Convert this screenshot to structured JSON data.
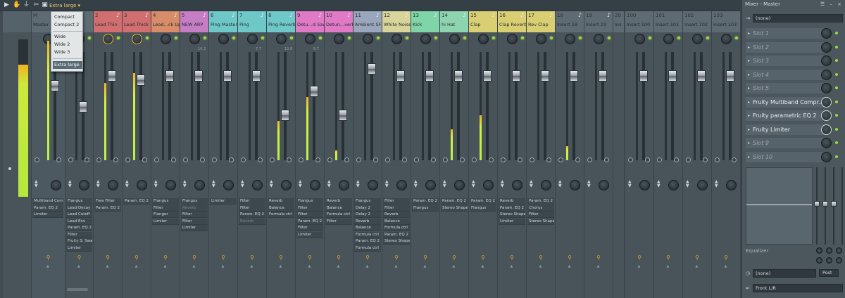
{
  "toolbar": {
    "layout_label": "Extra large",
    "icons": [
      "cursor-arrow-icon",
      "hand-icon",
      "pitchfork-icon",
      "scissors-icon",
      "panel-icon"
    ]
  },
  "layout_menu": {
    "items": [
      "Compact",
      "Compact 2",
      "Wide",
      "Wide 2",
      "Wide 3",
      "Extra large"
    ],
    "selected": "Extra large"
  },
  "channels": [
    {
      "num": "",
      "name": "",
      "color": "#56626a",
      "fx": []
    },
    {
      "num": "M",
      "name": "Master",
      "color": "#5f6b73",
      "fx": [
        "Multiband Comp",
        "Param. EQ 2",
        "Limiter"
      ]
    },
    {
      "num": "1",
      "name": "",
      "color": "#5f6b73",
      "fx": [
        "Flangus",
        "Lead Decay",
        "Lead Cutoff",
        "Lead Env",
        "Param. EQ 2",
        "Filter",
        "Fruity S. Swapper",
        "Limiter"
      ]
    },
    {
      "num": "2",
      "name": "Lead Thin",
      "color": "#d16f70",
      "fx": [
        "Free Filter",
        "Param. EQ 2"
      ]
    },
    {
      "num": "3",
      "name": "Lead Thick",
      "color": "#d16f70",
      "fx": [
        "Param. EQ 2"
      ]
    },
    {
      "num": "4",
      "name": "Lead...ck Up",
      "color": "#d88d68",
      "fx": [
        "Flangus",
        "Filter",
        "Flanger",
        "Limiter"
      ]
    },
    {
      "num": "5",
      "name": "NEW ARP",
      "color": "#c77dc4",
      "fx": [
        "Flangus",
        "Reverb",
        "Filter",
        "Filter",
        "Limiter"
      ]
    },
    {
      "num": "6",
      "name": "Ping Master",
      "color": "#6fc8c8",
      "fx": [
        "Limiter"
      ]
    },
    {
      "num": "7",
      "name": "Ping",
      "color": "#6fc8c8",
      "fx": [
        "Filter",
        "Filter",
        "Param. EQ 2",
        "Reverb"
      ]
    },
    {
      "num": "8",
      "name": "Ping Reverb",
      "color": "#6fc8c8",
      "fx": [
        "Reverb",
        "Balance",
        "Formula ctrl"
      ]
    },
    {
      "num": "9",
      "name": "Detu...d Saw",
      "color": "#e17ac6",
      "fx": [
        "Flangus",
        "Filter",
        "Filter",
        "Param. EQ 2",
        "Filter",
        "Limiter"
      ]
    },
    {
      "num": "10",
      "name": "Detun...verb",
      "color": "#e17ac6",
      "fx": [
        "Reverb",
        "Balance",
        "Formula ctrl",
        "Filter"
      ]
    },
    {
      "num": "11",
      "name": "Ambient SFX",
      "color": "#9aa6bb",
      "fx": [
        "Flangus",
        "Delay 2",
        "Delay 2",
        "Reverb",
        "Balance",
        "Formula ctrl",
        "Param. EQ 2",
        "Formula ctrl"
      ]
    },
    {
      "num": "12",
      "name": "White Noise",
      "color": "#d8d49a",
      "fx": [
        "Filter",
        "Filter",
        "Reverb",
        "Balance",
        "Formula ctrl",
        "Param. EQ 2",
        "Stereo Shaper"
      ]
    },
    {
      "num": "13",
      "name": "Kick",
      "color": "#7fd4a8",
      "fx": [
        "Param. EQ 2",
        "Flangus"
      ]
    },
    {
      "num": "14",
      "name": "hi Hat",
      "color": "#8fd4b0",
      "fx": [
        "Param. EQ 2",
        "Stereo Shaper"
      ]
    },
    {
      "num": "15",
      "name": "Clap",
      "color": "#d9cf72",
      "fx": [
        "Param. EQ 2",
        "Flangus"
      ]
    },
    {
      "num": "16",
      "name": "Clap Reverb",
      "color": "#d9cf72",
      "fx": [
        "Reverb",
        "Param. EQ 2",
        "Stereo Shaper",
        "Limiter"
      ]
    },
    {
      "num": "17",
      "name": "Rev Clap",
      "color": "#d9cf72",
      "fx": [
        "Param. EQ 2",
        "Chorus",
        "Filter",
        "Stereo Shaper"
      ]
    },
    {
      "num": "18",
      "name": "Insert 18",
      "color": "#5f6b73",
      "fx": []
    },
    {
      "num": "19",
      "name": "Insert 19",
      "color": "#5f6b73",
      "fx": []
    },
    {
      "num": "20",
      "name": "Ins",
      "color": "#5f6b73",
      "fx": []
    },
    {
      "num": "100",
      "name": "Insert 100",
      "color": "#5f6b73",
      "fx": []
    },
    {
      "num": "101",
      "name": "Insert 101",
      "color": "#5f6b73",
      "fx": []
    },
    {
      "num": "102",
      "name": "Insert 102",
      "color": "#5f6b73",
      "fx": []
    },
    {
      "num": "103",
      "name": "Insert 103",
      "color": "#5f6b73",
      "fx": []
    }
  ],
  "meter_values": [
    "",
    "",
    "",
    "",
    "",
    "",
    "10.3",
    "",
    "7.7",
    "10.8",
    "9.7",
    "",
    "",
    "",
    "",
    "",
    "",
    "",
    "",
    "",
    "",
    "",
    "",
    "",
    "",
    ""
  ],
  "panel": {
    "title": "Mixer - Master",
    "input": "(none)",
    "slots": [
      {
        "label": "Slot 1",
        "on": false
      },
      {
        "label": "Slot 2",
        "on": false
      },
      {
        "label": "Slot 3",
        "on": false
      },
      {
        "label": "Slot 4",
        "on": false
      },
      {
        "label": "Slot 5",
        "on": false
      },
      {
        "label": "Fruity Multiband Compr...",
        "on": true
      },
      {
        "label": "Fruity parametric EQ 2",
        "on": true
      },
      {
        "label": "Fruity Limiter",
        "on": true
      },
      {
        "label": "Slot 9",
        "on": false
      },
      {
        "label": "Slot 10",
        "on": false
      }
    ],
    "eq_label": "Equalizer",
    "output": "(none)",
    "post_label": "Post",
    "routing": "Front L/R"
  }
}
